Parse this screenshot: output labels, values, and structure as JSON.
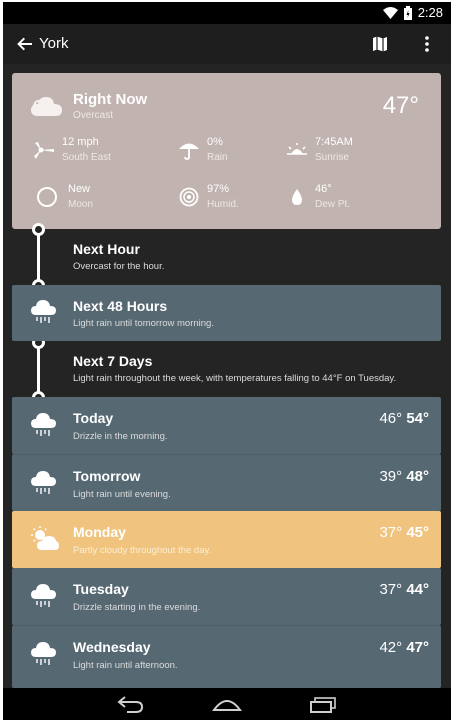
{
  "status": {
    "time": "2:28"
  },
  "appbar": {
    "title": "York"
  },
  "now": {
    "title": "Right Now",
    "subtitle": "Overcast",
    "temp": "47°",
    "stats": [
      {
        "value": "12 mph",
        "label": "South East",
        "icon": "wind-icon"
      },
      {
        "value": "0%",
        "label": "Rain",
        "icon": "umbrella-icon"
      },
      {
        "value": "7:45AM",
        "label": "Sunrise",
        "icon": "sunrise-icon"
      },
      {
        "value": "New",
        "label": "Moon",
        "icon": "moon-icon"
      },
      {
        "value": "97%",
        "label": "Humid.",
        "icon": "humidity-icon"
      },
      {
        "value": "46°",
        "label": "Dew Pt.",
        "icon": "drop-icon"
      }
    ]
  },
  "next_hour": {
    "title": "Next Hour",
    "desc": "Overcast for the hour."
  },
  "next_48": {
    "title": "Next 48 Hours",
    "desc": "Light rain until tomorrow morning."
  },
  "next_7": {
    "title": "Next 7 Days",
    "desc": "Light rain throughout the week, with temperatures falling to 44°F on Tuesday."
  },
  "days": [
    {
      "name": "Today",
      "desc": "Drizzle in the morning.",
      "low": "46°",
      "high": "54°",
      "icon": "rain-cloud-icon",
      "color": "#566872"
    },
    {
      "name": "Tomorrow",
      "desc": "Light rain until evening.",
      "low": "39°",
      "high": "48°",
      "icon": "rain-cloud-icon",
      "color": "#566872"
    },
    {
      "name": "Monday",
      "desc": "Partly cloudy throughout the day.",
      "low": "37°",
      "high": "45°",
      "icon": "partly-cloudy-icon",
      "color": "#f0c47f"
    },
    {
      "name": "Tuesday",
      "desc": "Drizzle starting in the evening.",
      "low": "37°",
      "high": "44°",
      "icon": "rain-cloud-icon",
      "color": "#566872"
    },
    {
      "name": "Wednesday",
      "desc": "Light rain until afternoon.",
      "low": "42°",
      "high": "47°",
      "icon": "rain-cloud-icon",
      "color": "#566872"
    }
  ],
  "colors": {
    "now_card": "#c1b3b0",
    "card": "#566872",
    "highlight": "#f0c47f"
  }
}
